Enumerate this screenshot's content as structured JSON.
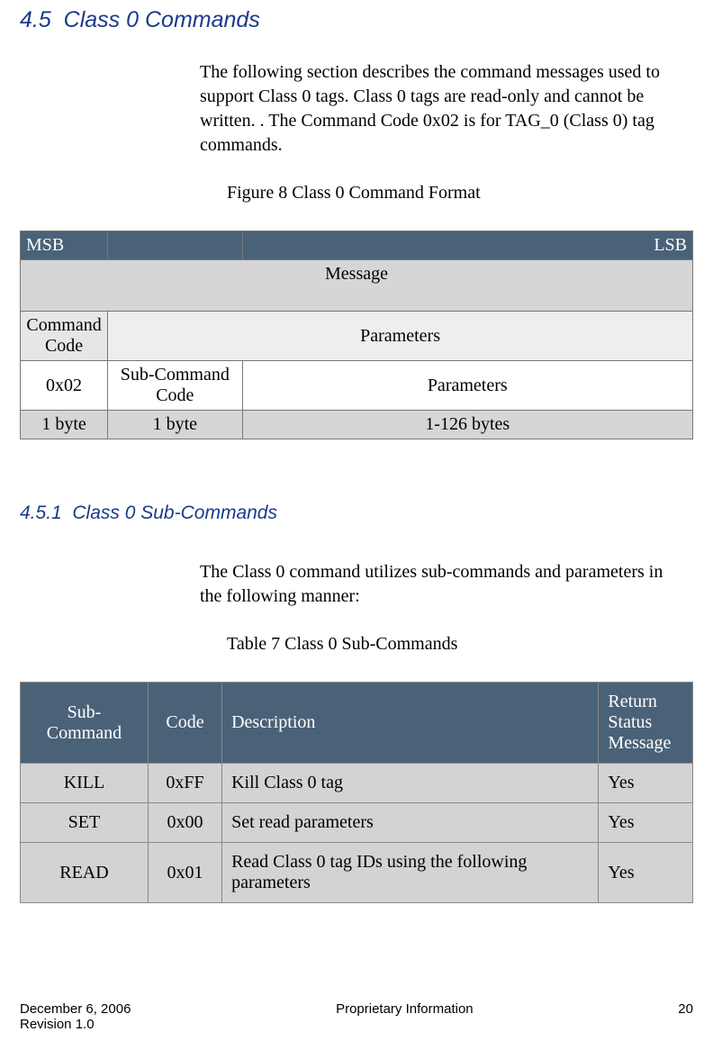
{
  "section": {
    "number": "4.5",
    "title": "Class 0 Commands",
    "intro": "The following section describes the command messages used to support Class 0 tags.  Class 0 tags are read-only and cannot be written. .  The Command Code 0x02 is for TAG_0 (Class 0) tag commands.",
    "figure_caption": "Figure 8 Class 0 Command Format"
  },
  "format_table": {
    "header_left": "MSB",
    "header_right": "LSB",
    "message": "Message",
    "cmd_code_label": "Command Code",
    "parameters_label": "Parameters",
    "cmd_code_value": "0x02",
    "sub_cmd_label": "Sub-Command Code",
    "parameters_label2": "Parameters",
    "bytes_cmd": "1 byte",
    "bytes_sub": "1 byte",
    "bytes_params": "1-126 bytes"
  },
  "subsection": {
    "number": "4.5.1",
    "title": "Class 0 Sub-Commands",
    "intro": "The Class 0 command utilizes sub-commands and parameters in the following manner:",
    "table_caption": "Table 7 Class 0 Sub-Commands"
  },
  "sub_table": {
    "headers": {
      "subcmd": "Sub-Command",
      "code": "Code",
      "desc": "Description",
      "ret": "Return Status Message"
    },
    "rows": [
      {
        "subcmd": "KILL",
        "code": "0xFF",
        "desc": "Kill Class 0 tag",
        "ret": "Yes"
      },
      {
        "subcmd": "SET",
        "code": "0x00",
        "desc": "Set read parameters",
        "ret": "Yes"
      },
      {
        "subcmd": "READ",
        "code": "0x01",
        "desc": "Read Class 0 tag IDs using the following parameters",
        "ret": "Yes"
      }
    ]
  },
  "footer": {
    "date": "December 6, 2006",
    "revision": "Revision 1.0",
    "center": "Proprietary Information",
    "page": "20"
  }
}
